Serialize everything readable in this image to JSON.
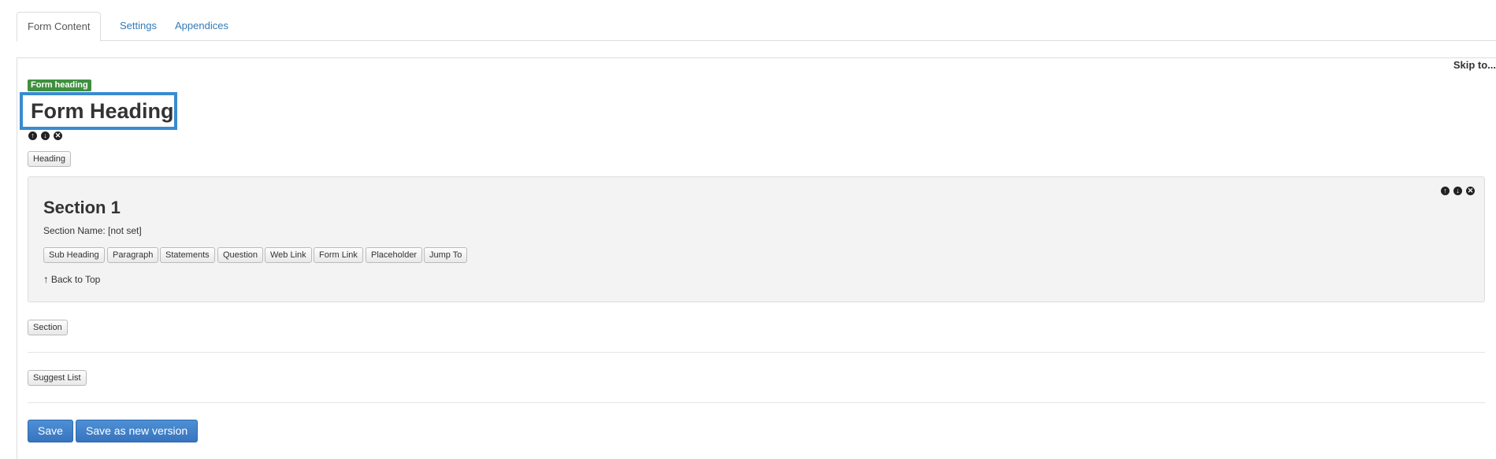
{
  "tabs": [
    {
      "label": "Form Content",
      "active": true
    },
    {
      "label": "Settings",
      "active": false
    },
    {
      "label": "Appendices",
      "active": false
    }
  ],
  "skip_to": "Skip to...",
  "form_heading": {
    "badge": "Form heading",
    "title": "Form Heading",
    "add_button": "Heading"
  },
  "section": {
    "title": "Section 1",
    "name_line": "Section Name: [not set]",
    "buttons": [
      "Sub Heading",
      "Paragraph",
      "Statements",
      "Question",
      "Web Link",
      "Form Link",
      "Placeholder",
      "Jump To"
    ],
    "back_to_top": "Back to Top"
  },
  "add_section_button": "Section",
  "suggest_list_button": "Suggest List",
  "actions": {
    "save": "Save",
    "save_new_version": "Save as new version"
  },
  "colors": {
    "accent_blue": "#3a8bd0",
    "badge_green": "#3f8f3f",
    "primary_button": "#3775bf"
  }
}
